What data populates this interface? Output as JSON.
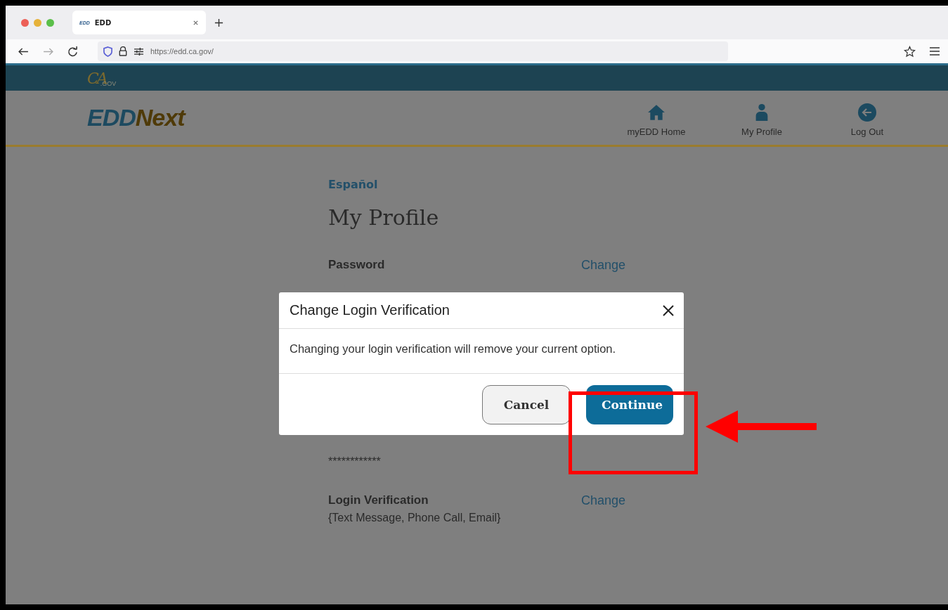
{
  "browser": {
    "tab": {
      "favicon": "EDD",
      "title": "EDD"
    },
    "url": "https://edd.ca.gov/"
  },
  "site": {
    "state_logo": {
      "initials": "CA",
      "suffix": ".GOV"
    },
    "logo": {
      "first": "EDD",
      "second": "Next"
    },
    "nav": [
      {
        "kind": "home",
        "label": "myEDD Home"
      },
      {
        "kind": "person",
        "label": "My Profile"
      },
      {
        "kind": "logout",
        "label": "Log Out"
      }
    ]
  },
  "page": {
    "language_link": "Español",
    "title": "My Profile",
    "sections": [
      {
        "label": "Password",
        "action": "Change"
      },
      {
        "value": "************"
      },
      {
        "label": "Login Verification",
        "value": "{Text Message, Phone Call, Email}",
        "action": "Change"
      }
    ]
  },
  "modal": {
    "title": "Change Login Verification",
    "message": "Changing your login verification will remove your current option.",
    "buttons": [
      {
        "kind": "secondary",
        "label": "Cancel"
      },
      {
        "kind": "primary",
        "label": "Continue"
      }
    ]
  }
}
